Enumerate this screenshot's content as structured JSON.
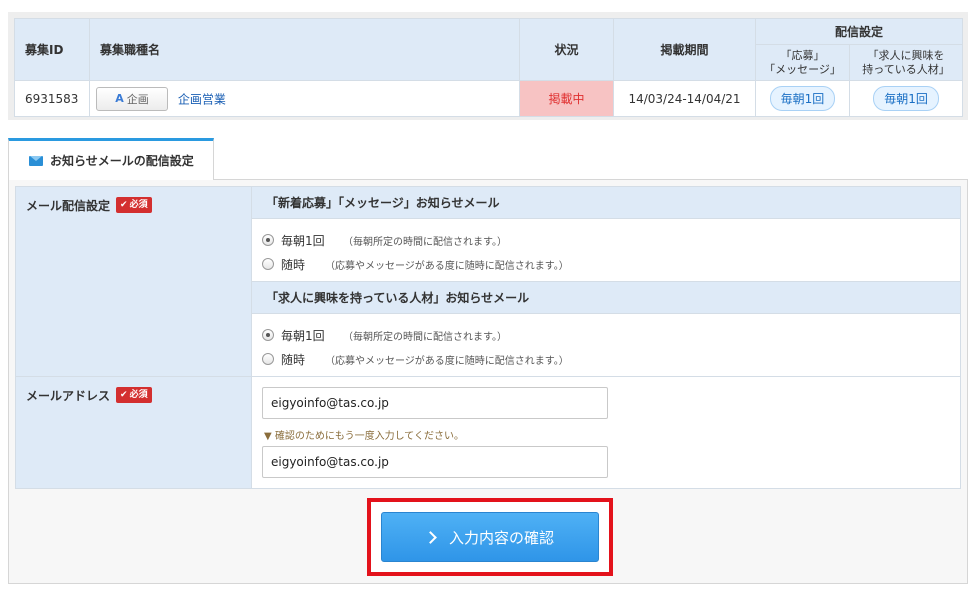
{
  "job_table": {
    "headers": {
      "id": "募集ID",
      "name": "募集職種名",
      "status": "状況",
      "period": "掲載期間",
      "delivery": "配信設定",
      "delivery_sub1": "「応募」\n「メッセージ」",
      "delivery_sub2": "「求人に興味を\n持っている人材」"
    },
    "row": {
      "id": "6931583",
      "btn_letter": "A",
      "btn_label": "企画",
      "name": "企画営業",
      "status": "掲載中",
      "period": "14/03/24-14/04/21",
      "pill1": "毎朝1回",
      "pill2": "毎朝1回"
    }
  },
  "tab": {
    "label": "お知らせメールの配信設定",
    "icon": "mail-icon"
  },
  "form": {
    "mail_setting": {
      "label": "メール配信設定",
      "required": "必須",
      "section1_title": "「新着応募」「メッセージ」お知らせメール",
      "section2_title": "「求人に興味を持っている人材」お知らせメール",
      "opt_daily": "毎朝1回",
      "opt_daily_note": "（毎朝所定の時間に配信されます。）",
      "opt_anytime": "随時",
      "opt_anytime_note": "（応募やメッセージがある度に随時に配信されます。）"
    },
    "email": {
      "label": "メールアドレス",
      "required": "必須",
      "value": "eigyoinfo@tas.co.jp",
      "confirm_note": "▼ 確認のためにもう一度入力してください。",
      "confirm_value": "eigyoinfo@tas.co.jp"
    }
  },
  "confirm_button": {
    "label": "入力内容の確認"
  },
  "colors": {
    "accent": "#2f95e8",
    "header_bg": "#deeaf7",
    "status_bg": "#f7c3c3",
    "highlight_frame": "#e3121b"
  }
}
